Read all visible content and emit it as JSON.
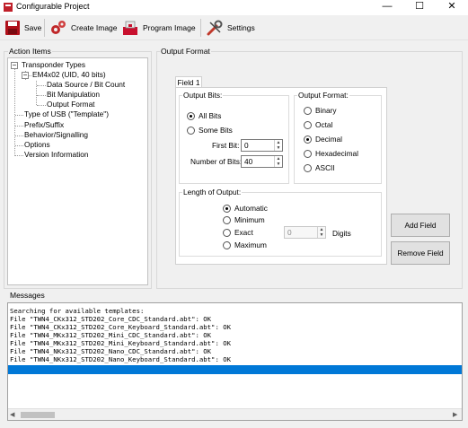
{
  "window": {
    "title": "Configurable Project",
    "minimize_glyph": "—",
    "maximize_glyph": "☐",
    "close_glyph": "✕"
  },
  "toolbar": {
    "save_label": "Save",
    "create_image_label": "Create Image",
    "program_image_label": "Program Image",
    "settings_label": "Settings"
  },
  "action_items": {
    "label": "Action Items",
    "tree": {
      "transponder_types": "Transponder Types",
      "em4x02": "EM4x02 (UID, 40 bits)",
      "data_source": "Data Source / Bit Count",
      "bit_manipulation": "Bit Manipulation",
      "output_format": "Output Format",
      "type_of_usb": "Type of USB (\"Template\")",
      "prefix_suffix": "Prefix/Suffix",
      "behavior": "Behavior/Signalling",
      "options": "Options",
      "version_info": "Version Information"
    }
  },
  "output_format_panel": {
    "label": "Output Format",
    "tab_field1": "Field 1",
    "output_bits": {
      "label": "Output Bits:",
      "all_bits": "All Bits",
      "some_bits": "Some Bits",
      "first_bit_label": "First Bit:",
      "first_bit_value": "0",
      "number_of_bits_label": "Number of Bits:",
      "number_of_bits_value": "40",
      "selected": "All Bits"
    },
    "output_format": {
      "label": "Output Format:",
      "options": [
        "Binary",
        "Octal",
        "Decimal",
        "Hexadecimal",
        "ASCII"
      ],
      "selected": "Decimal"
    },
    "length_of_output": {
      "label": "Length of Output:",
      "automatic": "Automatic",
      "minimum": "Minimum",
      "exact": "Exact",
      "maximum": "Maximum",
      "digits_value": "0",
      "digits_label": "Digits",
      "selected": "Automatic"
    },
    "add_field": "Add Field",
    "remove_field": "Remove Field"
  },
  "messages": {
    "label": "Messages",
    "lines": [
      "Searching for available templates:",
      "File \"TWN4_CKx312_STD202_Core_CDC_Standard.abt\": OK",
      "File \"TWN4_CKx312_STD202_Core_Keyboard_Standard.abt\": OK",
      "File \"TWN4_MKx312_STD202_Mini_CDC_Standard.abt\": OK",
      "File \"TWN4_MKx312_STD202_Mini_Keyboard_Standard.abt\": OK",
      "File \"TWN4_NKx312_STD202_Nano_CDC_Standard.abt\": OK",
      "File \"TWN4_NKx312_STD202_Nano_Keyboard_Standard.abt\": OK"
    ],
    "highlight_color": "#0078d7"
  },
  "colors": {
    "window_bg": "#f0f0f0",
    "save_icon": "#b0101a",
    "create_icon": "#c0282a",
    "program_icon": "#c8102e",
    "settings_icon": "#c0392b"
  }
}
